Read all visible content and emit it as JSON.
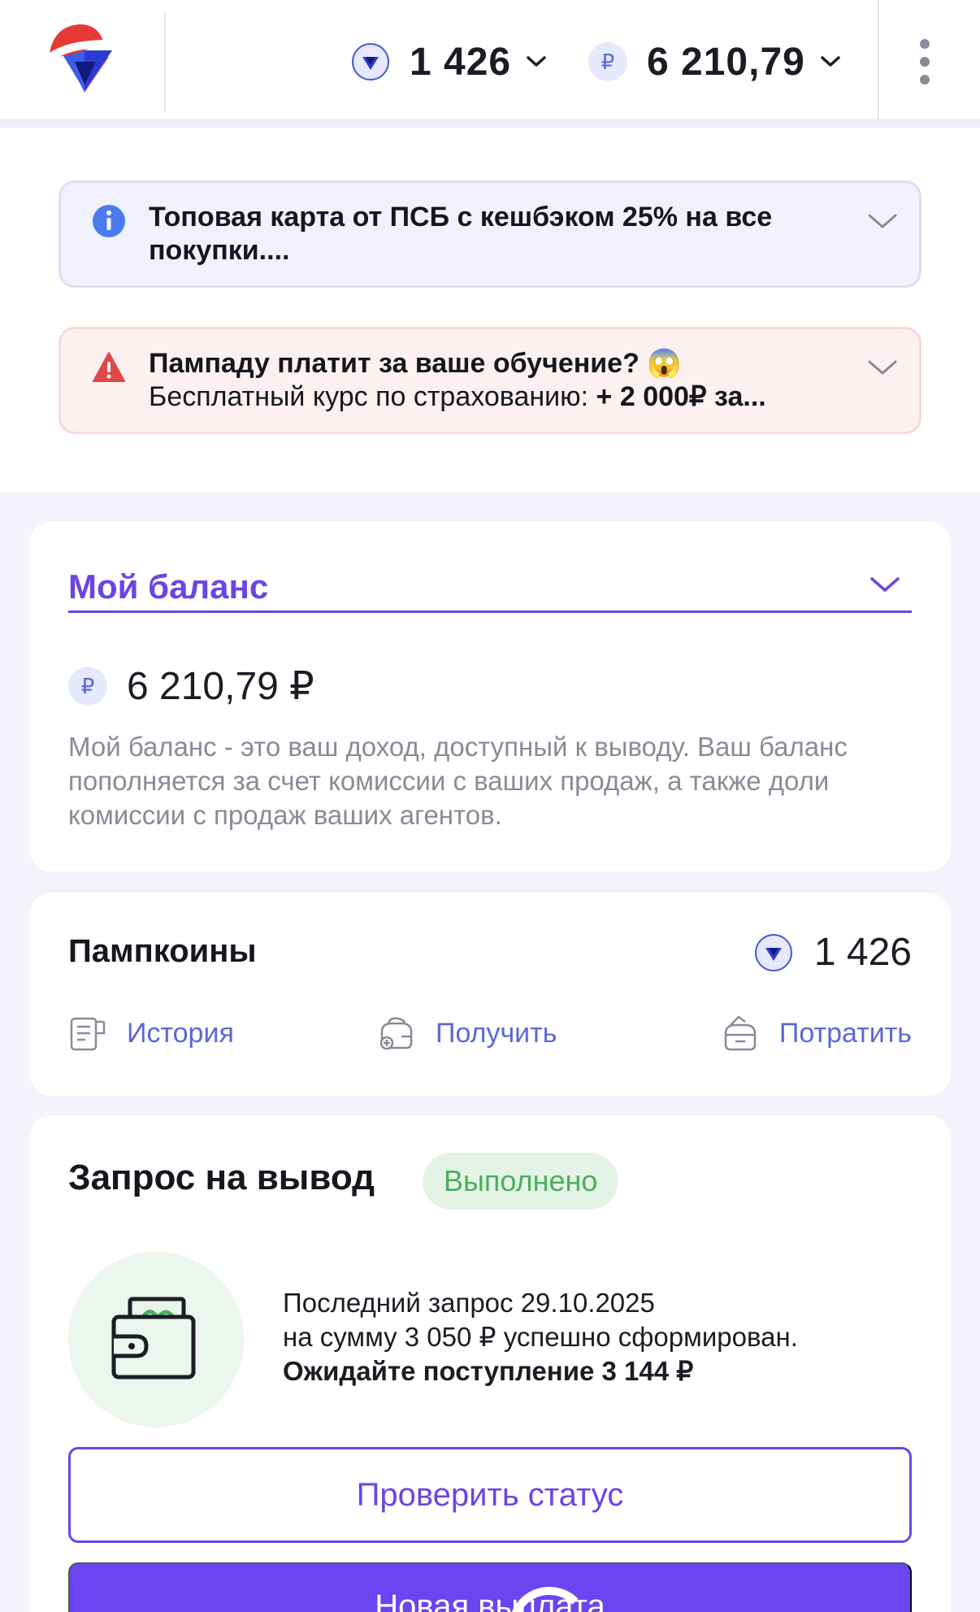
{
  "header": {
    "pumpcoins_value": "1 426",
    "balance_value": "6 210,79",
    "currency_symbol": "₽"
  },
  "banners": [
    {
      "type": "info",
      "line1": "Топовая карта от ПСБ с кешбэком 25% на все",
      "line2": "покупки...."
    },
    {
      "type": "warning",
      "line1": "Пампаду платит за ваше обучение? 😱",
      "line2_prefix": "Бесплатный курс по страхованию: ",
      "line2_bold": "+ 2 000₽",
      "line2_suffix": " за..."
    }
  ],
  "balance_card": {
    "title": "Мой баланс",
    "amount": "6 210,79 ₽",
    "description": "Мой баланс - это ваш доход, доступный к выводу. Ваш баланс пополняется за счет комиссии с ваших продаж, а также доли комиссии с продаж ваших агентов."
  },
  "pumpcoins_card": {
    "title": "Пампкоины",
    "value": "1 426",
    "actions": [
      {
        "label": "История",
        "icon": "history-icon"
      },
      {
        "label": "Получить",
        "icon": "get-coins-icon"
      },
      {
        "label": "Потратить",
        "icon": "spend-coins-icon"
      }
    ]
  },
  "withdraw_card": {
    "title": "Запрос на вывод",
    "status": "Выполнено",
    "line1": "Последний запрос 29.10.2025",
    "line2": "на сумму 3 050 ₽ успешно сформирован.",
    "line3": "Ожидайте поступление 3 144 ₽",
    "check_button": "Проверить статус",
    "new_button": "Новая выплата"
  },
  "colors": {
    "accent": "#6a45e6",
    "link": "#5a68d8",
    "success": "#4caf5c",
    "info": "#4a7cf0",
    "danger": "#e04848"
  }
}
